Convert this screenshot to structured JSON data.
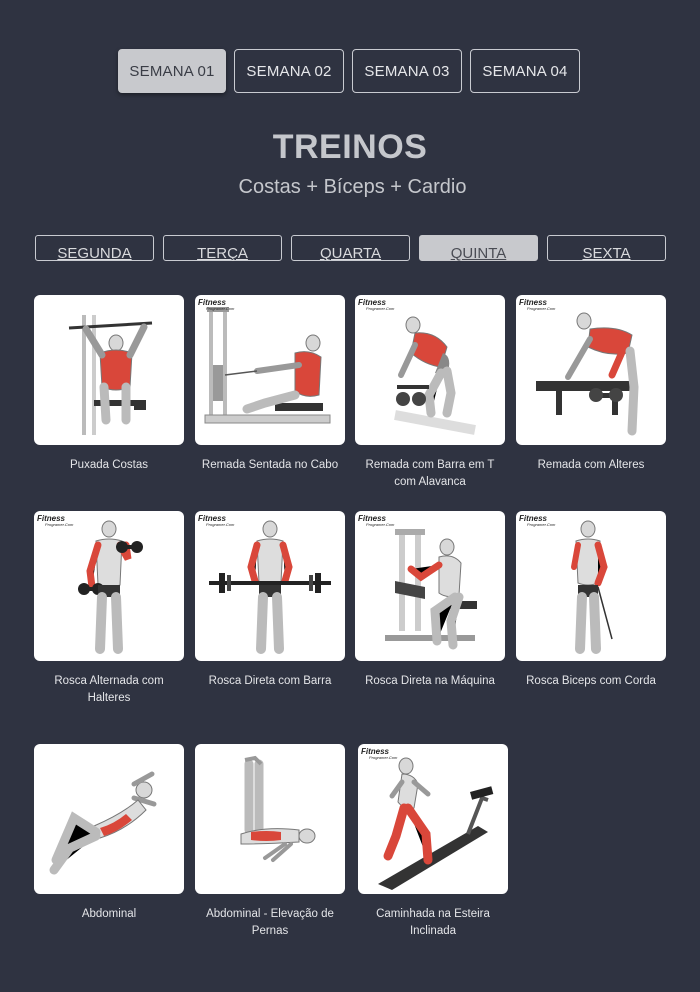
{
  "weeks": [
    "SEMANA 01",
    "SEMANA 02",
    "SEMANA 03",
    "SEMANA 04"
  ],
  "active_week": 0,
  "header": {
    "title": "TREINOS",
    "subtitle": "Costas + Bíceps + Cardio"
  },
  "days": [
    "SEGUNDA",
    "TERÇA",
    "QUARTA",
    "QUINTA",
    "SEXTA"
  ],
  "active_day": 3,
  "logo_text": "Fitness",
  "logo_sub": "Programer.Com",
  "exercises": [
    {
      "name": "Puxada Costas",
      "icon": "lat-pulldown-icon"
    },
    {
      "name": "Remada Sentada no Cabo",
      "icon": "seated-cable-row-icon"
    },
    {
      "name": "Remada com Barra em T com Alavanca",
      "icon": "t-bar-row-icon"
    },
    {
      "name": "Remada com Alteres",
      "icon": "dumbbell-row-icon"
    },
    {
      "name": "Rosca Alternada com Halteres",
      "icon": "alternating-curl-icon"
    },
    {
      "name": "Rosca Direta com Barra",
      "icon": "barbell-curl-icon"
    },
    {
      "name": "Rosca Direta na Máquina",
      "icon": "machine-curl-icon"
    },
    {
      "name": "Rosca Biceps com Corda",
      "icon": "rope-curl-icon"
    },
    {
      "name": "Abdominal",
      "icon": "crunch-icon"
    },
    {
      "name": "Abdominal - Elevação de Pernas",
      "icon": "leg-raise-icon"
    },
    {
      "name": "Caminhada na Esteira Inclinada",
      "icon": "treadmill-icon"
    }
  ],
  "colors": {
    "background": "#2f3341",
    "muscle": "#d9473a",
    "card": "#ffffff"
  }
}
